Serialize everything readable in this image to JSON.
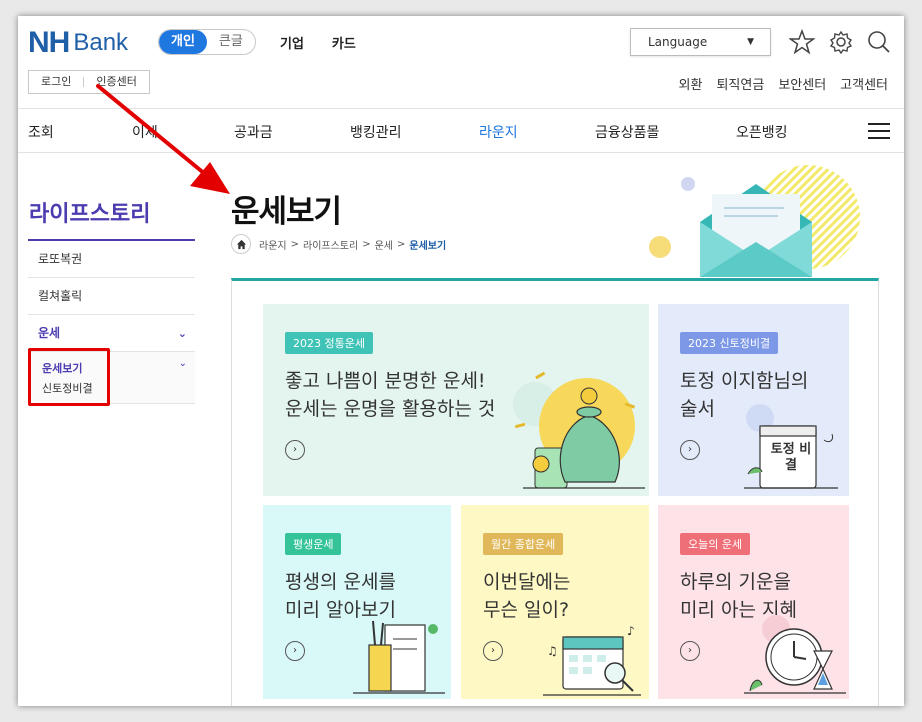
{
  "header": {
    "logo_nh": "NH",
    "logo_bank": "Bank",
    "segment": [
      "개인",
      "큰글"
    ],
    "topnav": [
      "기업",
      "카드"
    ],
    "language": "Language",
    "login": "로그인",
    "auth_center": "인증센터",
    "util_links": [
      "외환",
      "퇴직연금",
      "보안센터",
      "고객센터"
    ]
  },
  "menu": [
    "조회",
    "이체",
    "공과금",
    "뱅킹관리",
    "라운지",
    "금융상품몰",
    "오픈뱅킹"
  ],
  "sidebar": {
    "title": "라이프스토리",
    "items": [
      "로또복권",
      "컬쳐홀릭",
      "운세"
    ],
    "sub_items": [
      "운세보기",
      "신토정비결"
    ]
  },
  "page": {
    "title": "운세보기",
    "breadcrumb": [
      "라운지",
      "라이프스토리",
      "운세",
      "운세보기"
    ]
  },
  "cards": [
    {
      "tag": "2023 정통운세",
      "line1": "좋고 나쁨이 분명한 운세!",
      "line2": "운세는 운명을 활용하는 것"
    },
    {
      "tag": "2023 신토정비결",
      "line1": "토정 이지함님의",
      "line2": "술서",
      "book_text": "토정 비결"
    },
    {
      "tag": "평생운세",
      "line1": "평생의 운세를",
      "line2": "미리 알아보기"
    },
    {
      "tag": "월간 종합운세",
      "line1": "이번달에는",
      "line2": "무슨 일이?"
    },
    {
      "tag": "오늘의 운세",
      "line1": "하루의 기운을",
      "line2": "미리 아는 지혜"
    }
  ],
  "colors": {
    "brand": "#1f5fa8",
    "accent_blue": "#1f77e0",
    "sidebar_purple": "#4b3cb0",
    "teal": "#22a5a5",
    "highlight_red": "#e20000"
  }
}
